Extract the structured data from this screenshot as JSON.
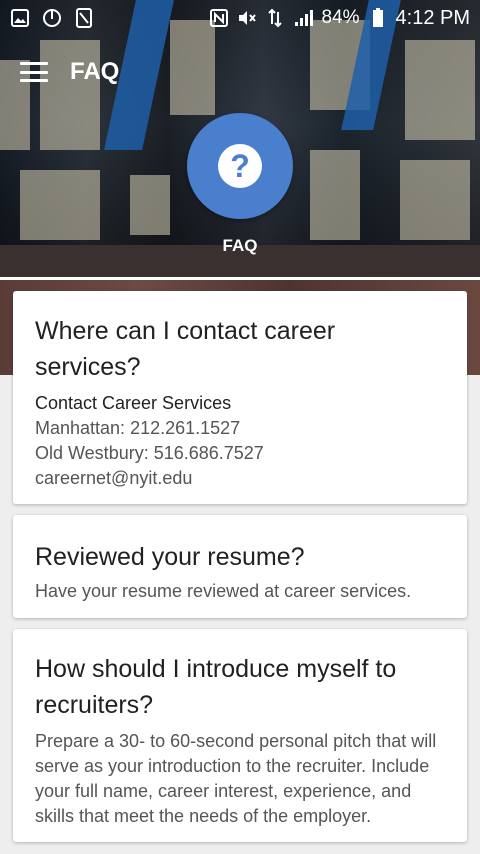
{
  "status": {
    "left_icons": [
      "gallery-icon",
      "power-icon",
      "sim-icon"
    ],
    "battery": "84%",
    "time": "4:12 PM"
  },
  "appbar": {
    "title": "FAQ"
  },
  "hero": {
    "label": "FAQ",
    "icon_glyph": "?"
  },
  "cards": [
    {
      "title": "Where can I contact career services?",
      "subtitle": "Contact Career Services",
      "lines": [
        "Manhattan: 212.261.1527",
        "Old Westbury: 516.686.7527",
        "careernet@nyit.edu"
      ]
    },
    {
      "title": "Reviewed your resume?",
      "body": "Have your resume reviewed at career services."
    },
    {
      "title": "How should I introduce myself to recruiters?",
      "body": "Prepare a 30- to 60-second personal pitch that will serve as your introduction to the recruiter. Include your full name, career interest, experience, and skills that meet the needs of the employer."
    }
  ],
  "colors": {
    "accent": "#4a7fcd",
    "card_bg": "#ffffff",
    "page_bg": "#eeeeee"
  }
}
